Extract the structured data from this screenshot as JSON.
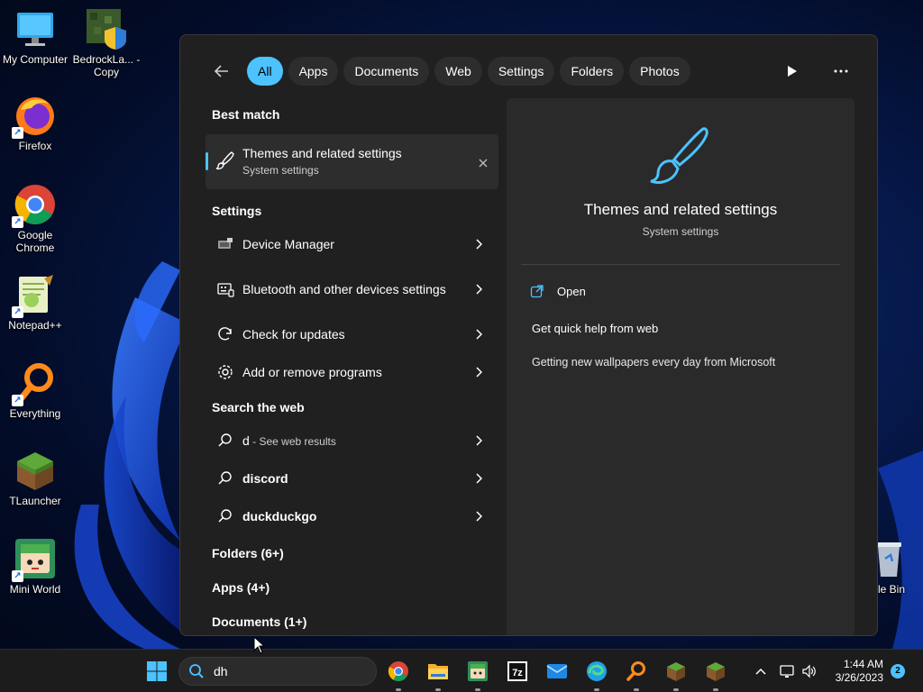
{
  "desktop": {
    "icons": [
      {
        "label": "My Computer"
      },
      {
        "label": "BedrockLa... - Copy"
      },
      {
        "label": "Firefox"
      },
      {
        "label": "Google Chrome"
      },
      {
        "label": "Notepad++"
      },
      {
        "label": "Everything"
      },
      {
        "label": "TLauncher"
      },
      {
        "label": "Mini World"
      },
      {
        "label": "cle Bin"
      }
    ]
  },
  "search_panel": {
    "filters": [
      "All",
      "Apps",
      "Documents",
      "Web",
      "Settings",
      "Folders",
      "Photos"
    ],
    "active_filter": "All",
    "best_match": {
      "heading": "Best match",
      "title": "Themes and related settings",
      "subtitle": "System settings"
    },
    "settings": {
      "heading": "Settings",
      "items": [
        {
          "label": "Device Manager",
          "icon": "device-manager-icon"
        },
        {
          "label": "Bluetooth and other devices settings",
          "icon": "bluetooth-devices-icon"
        },
        {
          "label": "Check for updates",
          "icon": "refresh-icon"
        },
        {
          "label": "Add or remove programs",
          "icon": "gear-icon"
        }
      ]
    },
    "web": {
      "heading": "Search the web",
      "items": [
        {
          "label": "d",
          "sub": " - See web results"
        },
        {
          "label": "discord",
          "sub": ""
        },
        {
          "label": "duckduckgo",
          "sub": ""
        }
      ]
    },
    "folders_heading": "Folders (6+)",
    "apps_heading": "Apps (4+)",
    "documents_heading": "Documents (1+)",
    "preview": {
      "title": "Themes and related settings",
      "subtitle": "System settings",
      "open_label": "Open",
      "quick_help": "Get quick help from web",
      "link1": "Getting new wallpapers every day from Microsoft"
    }
  },
  "taskbar": {
    "search_value": "dh",
    "time": "1:44 AM",
    "date": "3/26/2023",
    "notification_count": "2"
  },
  "colors": {
    "accent": "#4cc2ff",
    "panel_bg": "#202020",
    "taskbar_bg": "#1c1c1c"
  }
}
